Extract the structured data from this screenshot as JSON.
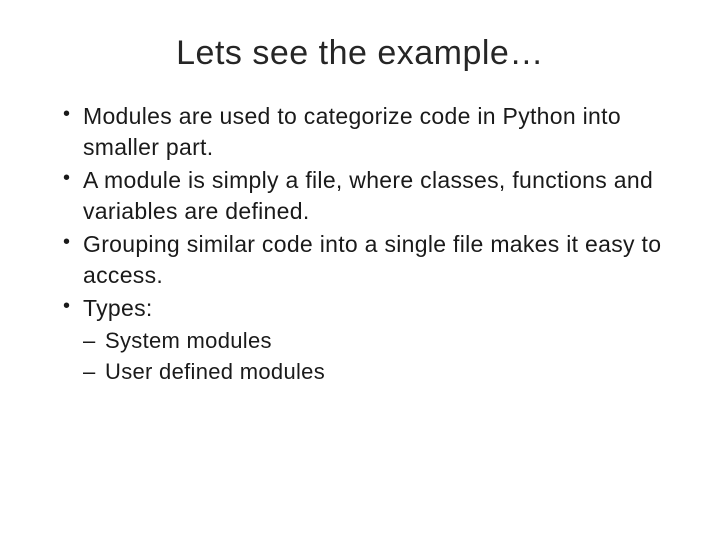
{
  "slide": {
    "title": "Lets see the example…",
    "bullets": [
      "Modules are used to categorize code in Python  into smaller part.",
      "A module is simply a file, where classes,  functions and variables are defined.",
      "Grouping similar code into a single file makes it  easy to access.",
      "Types:"
    ],
    "subbullets": [
      "System modules",
      "User defined modules"
    ]
  }
}
